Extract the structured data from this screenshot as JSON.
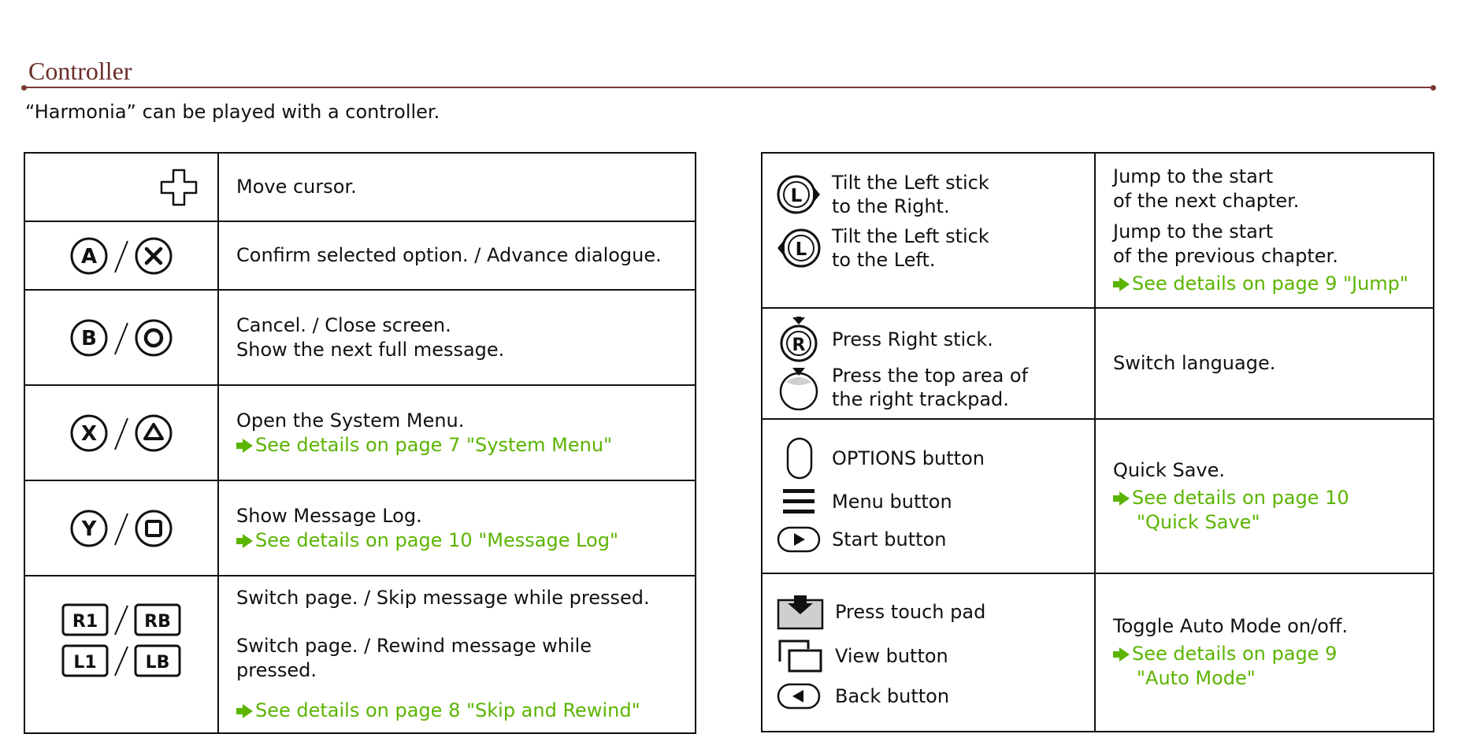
{
  "header": {
    "title": "Controller",
    "intro": "“Harmonia” can be played with a controller."
  },
  "left_table": {
    "dpad_text": "Move cursor.",
    "a_x_text": "Confirm selected option. / Advance dialogue.",
    "b_o": {
      "line1": "Cancel. / Close screen.",
      "line2": "Show the next full message."
    },
    "x_tri": {
      "line1": "Open the System Menu.",
      "link": "See details on page 7 \"System Menu\""
    },
    "y_sq": {
      "line1": "Show Message Log.",
      "link": "See details on page 10 \"Message Log\""
    },
    "shoulders": {
      "line1": "Switch page. / Skip message while pressed.",
      "line2": "Switch page. / Rewind message while pressed.",
      "link": "See details on page 8 \"Skip and Rewind\"",
      "keys": [
        "R1",
        "RB",
        "L1",
        "LB"
      ]
    },
    "button_letters": [
      "A",
      "X",
      "B",
      "Y"
    ]
  },
  "right_table": {
    "jump": {
      "right_label": [
        "Tilt the Left stick",
        "to the Right."
      ],
      "left_label": [
        "Tilt the Left stick",
        "to the Left."
      ],
      "next_text": [
        "Jump to the start",
        "of the next chapter."
      ],
      "prev_text": [
        "Jump to the start",
        "of the previous chapter."
      ],
      "link": "See details on page 9 \"Jump\"",
      "stick_letter": "L"
    },
    "language": {
      "rstick_label": "Press Right stick.",
      "trackpad_label": [
        "Press the top area of",
        "the right trackpad."
      ],
      "text": "Switch language.",
      "stick_letter": "R"
    },
    "quick_save": {
      "options_label": "OPTIONS button",
      "menu_label": "Menu button",
      "start_label": "Start button",
      "text": "Quick Save.",
      "link": [
        "See details on page 10",
        "\"Quick Save\""
      ]
    },
    "auto_mode": {
      "touchpad_label": "Press touch pad",
      "view_label": "View button",
      "back_label": "Back button",
      "text": "Toggle Auto Mode on/off.",
      "link": [
        "See details on page 9",
        "\"Auto Mode\""
      ]
    }
  },
  "colors": {
    "title": "#6b2e2a",
    "rule": "#7a3a34",
    "link": "#5bb400",
    "text": "#111111"
  }
}
